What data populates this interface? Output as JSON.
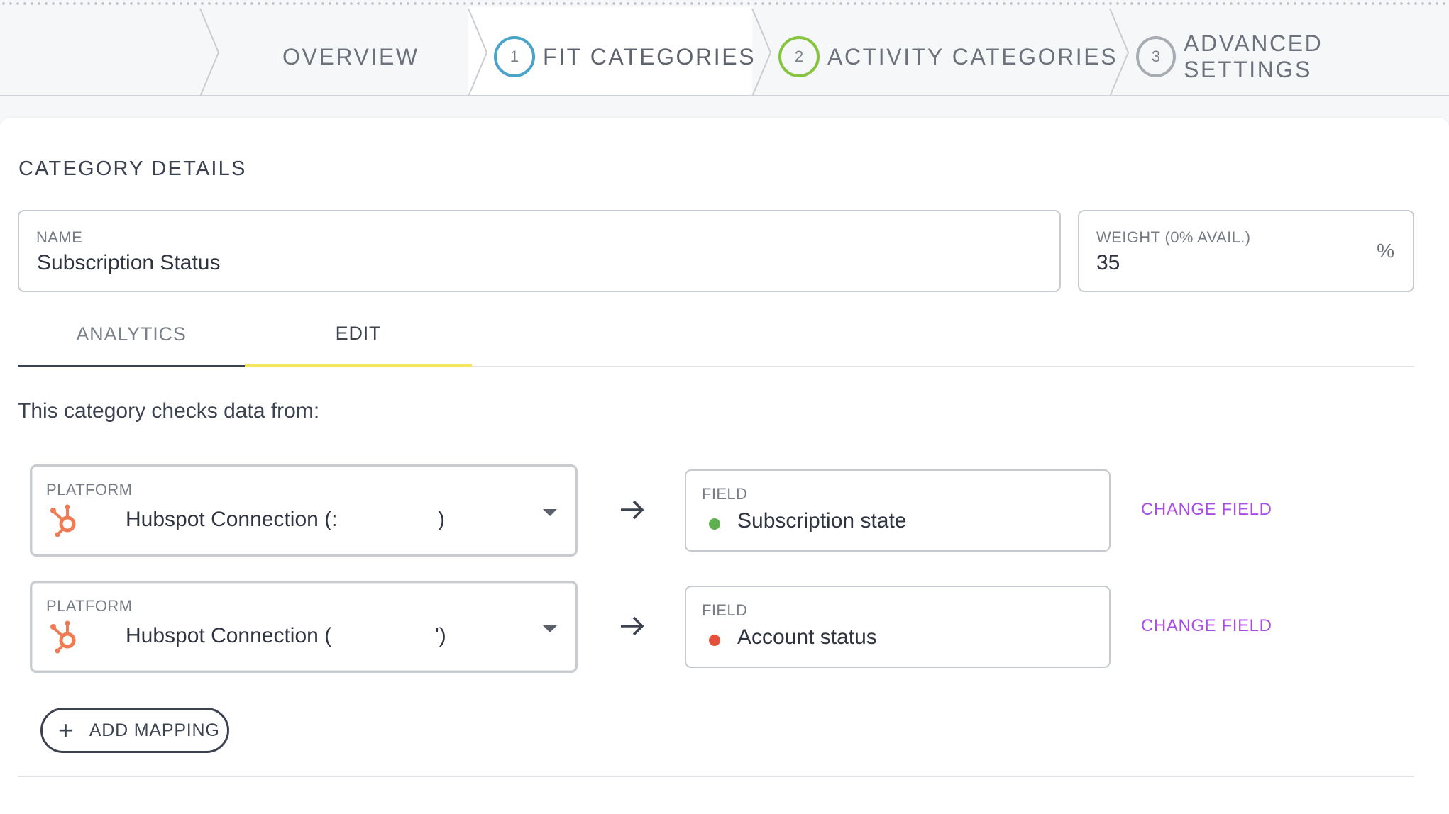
{
  "stepper": {
    "steps": [
      {
        "label": "OVERVIEW",
        "number": ""
      },
      {
        "label": "FIT CATEGORIES",
        "number": "1",
        "color": "#4aa3c8"
      },
      {
        "label": "ACTIVITY CATEGORIES",
        "number": "2",
        "color": "#86c440"
      },
      {
        "label": "ADVANCED SETTINGS",
        "number": "3",
        "color": "#a7acb3"
      }
    ]
  },
  "category": {
    "section_title": "CATEGORY DETAILS",
    "name_label": "NAME",
    "name_value": "Subscription Status",
    "weight_label": "WEIGHT (0% AVAIL.)",
    "weight_value": "35",
    "weight_suffix": "%"
  },
  "tabs": [
    {
      "label": "ANALYTICS",
      "active": false
    },
    {
      "label": "EDIT",
      "active": true
    }
  ],
  "edit": {
    "intro": "This category checks data from:",
    "mappings": [
      {
        "platform_label": "PLATFORM",
        "platform_value": "Hubspot Connection (:",
        "platform_close": ")",
        "field_label": "FIELD",
        "field_value": "Subscription state",
        "status_color": "#5fb04f",
        "change_label": "CHANGE FIELD"
      },
      {
        "platform_label": "PLATFORM",
        "platform_value": "Hubspot Connection (",
        "platform_close": "')",
        "field_label": "FIELD",
        "field_value": "Account status",
        "status_color": "#e4503b",
        "change_label": "CHANGE FIELD"
      }
    ],
    "add_mapping_label": "ADD MAPPING"
  },
  "colors": {
    "accent_link": "#a84ee6",
    "tab_indicator": "#f2e65d",
    "hubspot": "#f07b52"
  },
  "icons": [
    "hubspot-icon",
    "arrow-right-icon",
    "caret-down-icon",
    "plus-icon"
  ]
}
